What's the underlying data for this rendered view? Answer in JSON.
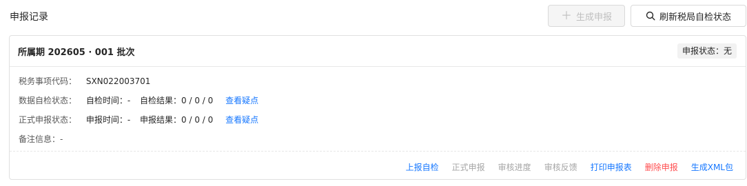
{
  "page": {
    "title": "申报记录"
  },
  "toolbar": {
    "generate_label": "生成申报",
    "refresh_label": "刷新税局自检状态"
  },
  "record": {
    "title": "所属期 202605 · 001 批次",
    "status": "申报状态：无",
    "tax_code_label": "税务事项代码：",
    "tax_code_value": "SXN022003701",
    "selfcheck_label": "数据自检状态：",
    "selfcheck_time": "自检时间：-",
    "selfcheck_result": "自检结果：0 / 0 / 0",
    "selfcheck_link": "查看疑点",
    "formal_label": "正式申报状态：",
    "formal_time": "申报时间：-",
    "formal_result": "申报结果：0 / 0 / 0",
    "formal_link": "查看疑点",
    "remark": "备注信息：-"
  },
  "actions": {
    "upload_selfcheck": "上报自检",
    "formal_submit": "正式申报",
    "review_progress": "审核进度",
    "review_feedback": "审核反馈",
    "print_report": "打印申报表",
    "delete_report": "删除申报",
    "generate_xml": "生成XML包"
  },
  "colors": {
    "link": "#1677ff",
    "danger": "#ff4d4f",
    "disabled": "#a6a6a6"
  }
}
